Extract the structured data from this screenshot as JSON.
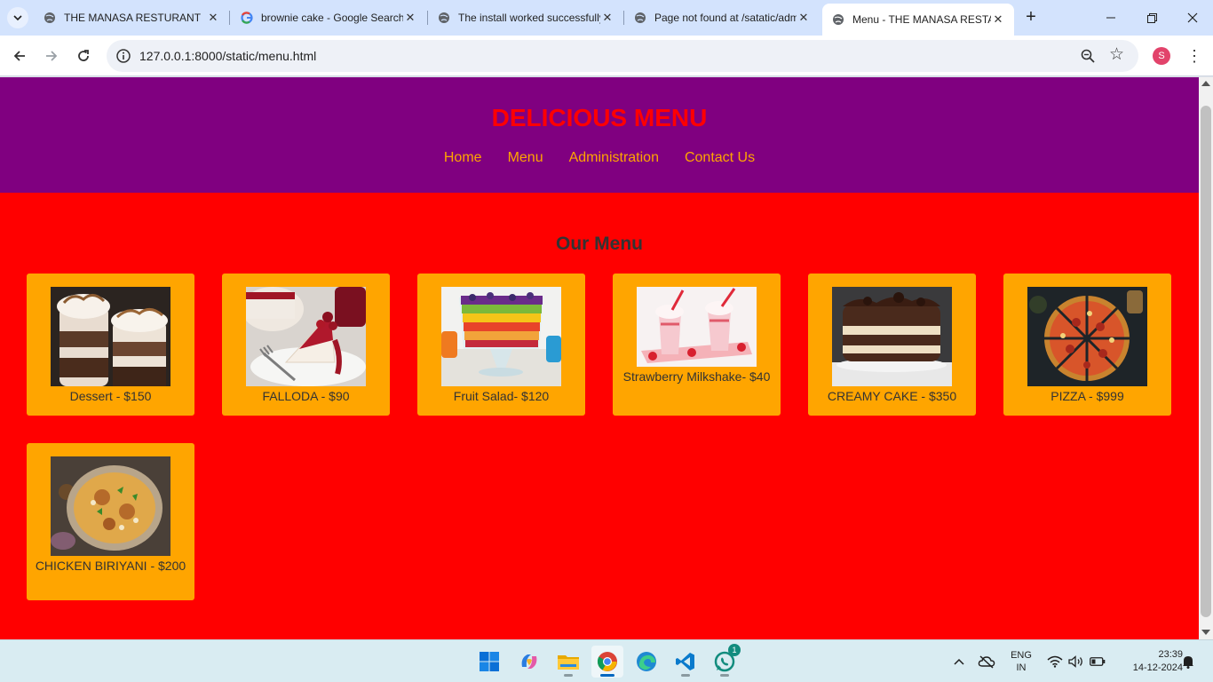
{
  "browser": {
    "tabs": [
      {
        "title": "THE MANASA RESTURANT",
        "favicon": "globe-icon",
        "active": false
      },
      {
        "title": "brownie cake - Google Search",
        "favicon": "google-icon",
        "active": false
      },
      {
        "title": "The install worked successfully",
        "favicon": "globe-icon",
        "active": false
      },
      {
        "title": "Page not found at /satatic/admin",
        "favicon": "globe-icon",
        "active": false
      },
      {
        "title": "Menu - THE MANASA RESTAURANT",
        "favicon": "globe-icon",
        "active": true
      }
    ],
    "url": "127.0.0.1:8000/static/menu.html",
    "profile_initial": "S"
  },
  "page": {
    "title": "DELICIOUS MENU",
    "nav": [
      "Home",
      "Menu",
      "Administration",
      "Contact Us"
    ],
    "section_title": "Our Menu",
    "items": [
      {
        "name": "Dessert - $150",
        "photo": "layered-dessert-cups"
      },
      {
        "name": "FALLODA - $90",
        "photo": "berry-cheesecake"
      },
      {
        "name": "Fruit Salad- $120",
        "photo": "fruit-trifle"
      },
      {
        "name": "Strawberry Milkshake- $40",
        "photo": "strawberry-milkshakes"
      },
      {
        "name": "CREAMY CAKE - $350",
        "photo": "chocolate-layer-cake"
      },
      {
        "name": "PIZZA - $999",
        "photo": "sliced-pizza"
      },
      {
        "name": "CHICKEN BIRIYANI - $200",
        "photo": "chicken-biryani"
      }
    ],
    "colors": {
      "header_bg": "#800080",
      "title": "#ff0000",
      "nav_link": "#ffa500",
      "body_bg": "#ff0000",
      "card_bg": "#ffa500"
    }
  },
  "taskbar": {
    "apps": [
      "windows-start",
      "copilot",
      "file-explorer",
      "chrome",
      "edge",
      "vscode",
      "whatsapp"
    ],
    "whatsapp_badge": "1",
    "lang_line1": "ENG",
    "lang_line2": "IN",
    "time": "23:39",
    "date": "14-12-2024"
  }
}
